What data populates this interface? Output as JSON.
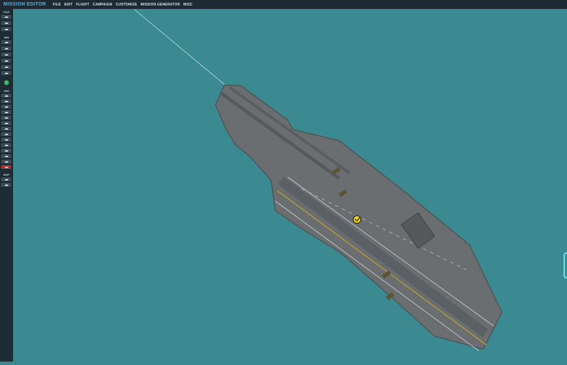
{
  "app": {
    "title": "MISSION EDITOR"
  },
  "menu": [
    {
      "label": "FILE"
    },
    {
      "label": "EDIT"
    },
    {
      "label": "FLIGHT"
    },
    {
      "label": "CAMPAIGN"
    },
    {
      "label": "CUSTOMIZE"
    },
    {
      "label": "MISSION GENERATOR"
    },
    {
      "label": "MISC"
    }
  ],
  "sidebar": {
    "file_label": "FILE",
    "mis_label": "MIS",
    "obj_label": "OBJ",
    "map_label": "MAP"
  },
  "colors": {
    "sea": "#3b8a92",
    "deck": "#6a6e70",
    "topbar": "#1d2a33",
    "sidebar": "#1e2c35",
    "accent": "#4fb6e8",
    "unit_marker": "#f0d21a",
    "deck_line_yellow": "#c9a524"
  }
}
